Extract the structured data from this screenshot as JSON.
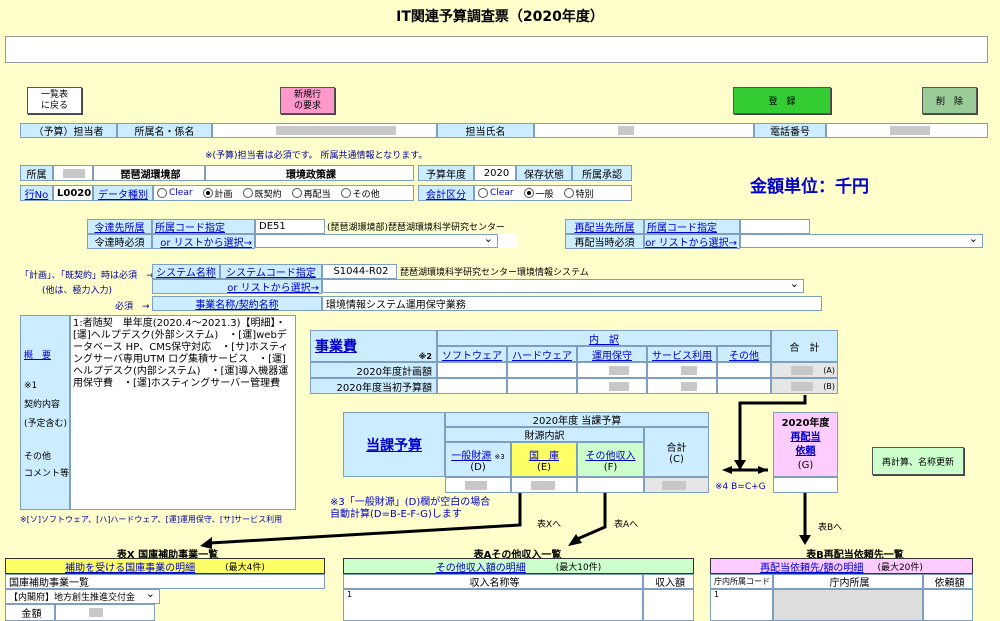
{
  "title": "IT関連予算調査票（2020年度）",
  "buttons": {
    "back": "一覧表\nに戻る",
    "new_request": "新規行\nの要求",
    "register": "登　録",
    "delete": "削　除",
    "recalc": "再計算、名称更新"
  },
  "row1": {
    "budget_person": "（予算）担当者",
    "office": "所属名・係名",
    "person_name": "担当氏名",
    "phone": "電話番号"
  },
  "note_required": "※(予算)担当者は必須です。 所属共通情報となります。",
  "dept": {
    "label": "所属",
    "name": "琵琶湖環境部",
    "section": "環境政策課",
    "row_no_label": "行No",
    "row_no": "L0020",
    "data_type_label": "データ種別",
    "types": [
      "Clear",
      "計画",
      "既契約",
      "再配当",
      "その他"
    ],
    "type_selected": 1
  },
  "year_block": {
    "budget_year_label": "予算年度",
    "budget_year": "2020",
    "status_label": "保存状態",
    "approval_label": "所属承認",
    "account_label": "会計区分",
    "accounts": [
      "Clear",
      "一般",
      "特別"
    ],
    "account_selected": 1
  },
  "unit": "金額単位：千円",
  "realloc_src": {
    "label1": "令達先所属",
    "label2": "令達時必須",
    "code_label": "所属コード指定",
    "or_list": "or リストから選択→",
    "code": "DE51",
    "name": "(琵琶湖環境部)琵琶湖環境科学研究センター"
  },
  "realloc_dst": {
    "label1": "再配当先所属",
    "label2": "再配当時必須",
    "code_label": "所属コード指定",
    "or_list": "or リストから選択→"
  },
  "system": {
    "note1": "「計画」、「既契約」時は必須　→",
    "note2": "(他は、極力入力)",
    "required": "必須　→",
    "sys_name_label": "システム名称",
    "sys_code_label": "システムコード指定",
    "sys_code": "S1044-R02",
    "sys_name": "琵琶湖環境科学研究センター環境情報システム",
    "or_list": "or リストから選択→",
    "project_label": "事業名称/契約名称",
    "project_name": "環境情報システム運用保守業務"
  },
  "left_labels": {
    "gaiyou": "概　要",
    "note1": "※1",
    "keiyaku": "契約内容",
    "yotei": "(予定含む)",
    "sonota": "その他",
    "comment": "コメント等"
  },
  "description": "1:者随契　単年度(2020.4～2021.3)【明細】・[運]ヘルプデスク(外部システム)　・[運]webデータベース HP、CMS保守対応　・[サ]ホスティングサーバ専用UTM ログ集積サービス　・[運]ヘルプデスク(内部システム)　・[運]導入機器運用保守費　・[運]ホスティングサーバー管理費",
  "legend_note": "※[ソ]ソフトウェア、[ハ]ハードウェア、[運]運用保守、[サ]サービス利用",
  "jigyohi": {
    "title": "事業費",
    "note2": "※2",
    "naiyaku": "内　訳",
    "cols": [
      "ソフトウェア",
      "ハードウェア",
      "運用保守",
      "サービス利用",
      "その他"
    ],
    "total": "合　計",
    "rows": [
      "2020年度計画額",
      "2020年度当初予算額"
    ],
    "marks": [
      "(A)",
      "(B)"
    ]
  },
  "touka": {
    "title": "当課予算",
    "header": "2020年度 当課予算",
    "sub": "財源内訳",
    "cols": [
      "一般財源",
      "国　庫",
      "その他収入"
    ],
    "note3": "※3",
    "letters": [
      "(D)",
      "(E)",
      "(F)"
    ],
    "total": "合計",
    "total_letter": "(C)"
  },
  "realloc_req": {
    "year": "2020年度",
    "l1": "再配当",
    "l2": "依頼",
    "letter": "(G)"
  },
  "note4": "※4 B=C+G",
  "note3_text": "※3「一般財源」(D)欄が空白の場合\n自動計算(D=B-E-F-G)します",
  "arrows": {
    "x": "表Xへ",
    "a": "表Aへ",
    "b": "表Bへ"
  },
  "tableX": {
    "title": "表X 国庫補助事業一覧",
    "subtitle": "補助を受ける国庫事業の明細",
    "max": "(最大4件)",
    "col": "国庫補助事業一覧",
    "item": "【内閣府】地方創生推進交付金",
    "kin": "金額"
  },
  "tableA": {
    "title": "表Aその他収入一覧",
    "subtitle": "その他収入額の明細",
    "max": "(最大10件)",
    "col1": "収入名称等",
    "col2": "収入額",
    "row1": "1"
  },
  "tableB": {
    "title": "表B再配当依頼先一覧",
    "subtitle": "再配当依頼先/額の明細",
    "max": "(最大20件)",
    "col1": "庁内所属コード",
    "col2": "庁内所属",
    "col3": "依頼額",
    "row1": "1"
  }
}
